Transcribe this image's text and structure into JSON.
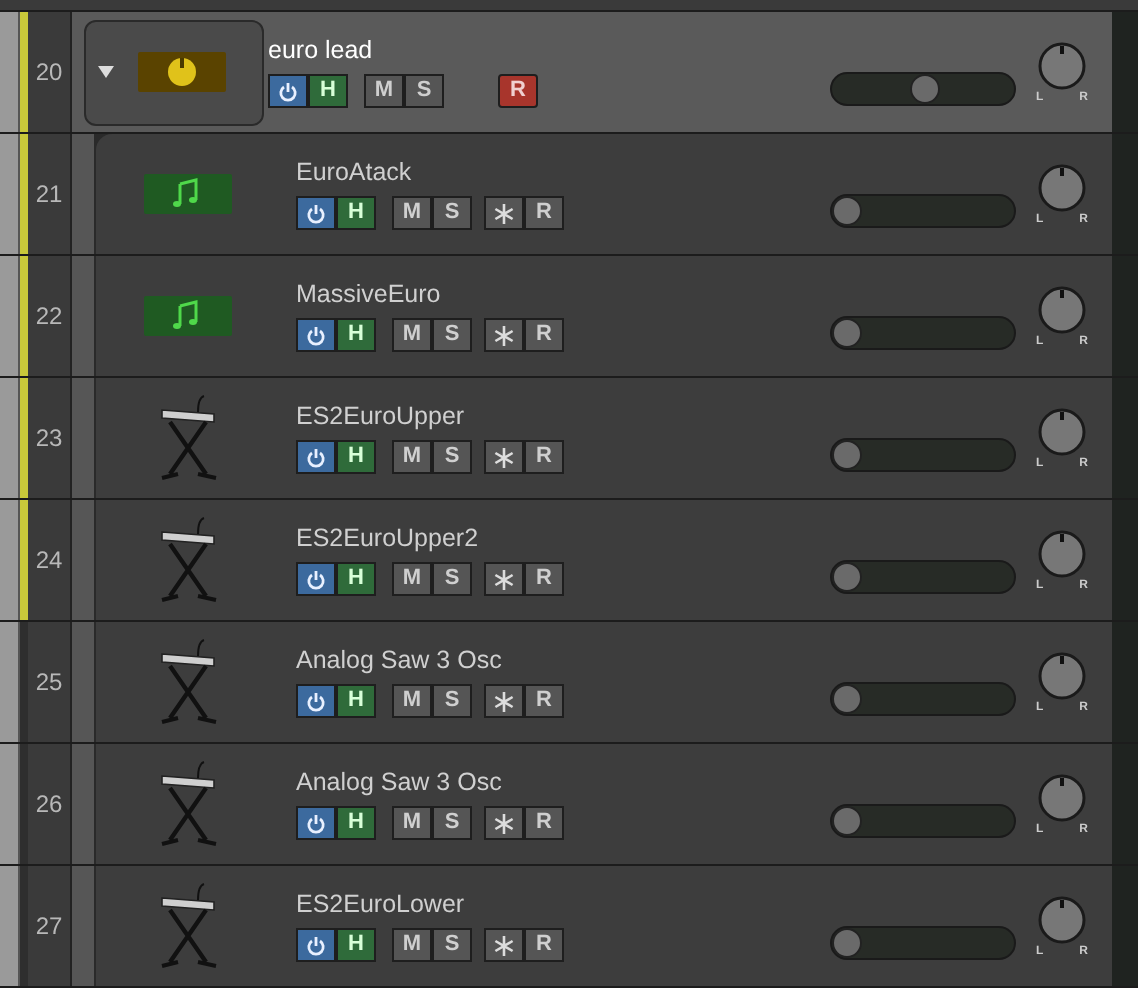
{
  "tracks": [
    {
      "number": "20",
      "name": "euro lead",
      "kind": "summing",
      "selected": true,
      "expanded": true,
      "marked": true,
      "buttons": {
        "power": true,
        "hide": "H",
        "mute": "M",
        "solo": "S",
        "record": "R"
      },
      "level": 0.5,
      "pan": {
        "left": "L",
        "right": "R"
      }
    },
    {
      "number": "21",
      "name": "EuroAtack",
      "kind": "audio",
      "selected": false,
      "marked": true,
      "buttons": {
        "power": true,
        "hide": "H",
        "mute": "M",
        "solo": "S",
        "record": "R"
      },
      "freeze": true,
      "level": 0,
      "pan": {
        "left": "L",
        "right": "R"
      }
    },
    {
      "number": "22",
      "name": "MassiveEuro",
      "kind": "audio",
      "selected": false,
      "marked": true,
      "buttons": {
        "power": true,
        "hide": "H",
        "mute": "M",
        "solo": "S",
        "record": "R"
      },
      "freeze": true,
      "level": 0,
      "pan": {
        "left": "L",
        "right": "R"
      }
    },
    {
      "number": "23",
      "name": "ES2EuroUpper",
      "kind": "instrument",
      "selected": false,
      "marked": true,
      "buttons": {
        "power": true,
        "hide": "H",
        "mute": "M",
        "solo": "S",
        "record": "R"
      },
      "freeze": true,
      "level": 0,
      "pan": {
        "left": "L",
        "right": "R"
      }
    },
    {
      "number": "24",
      "name": "ES2EuroUpper2",
      "kind": "instrument",
      "selected": false,
      "marked": true,
      "buttons": {
        "power": true,
        "hide": "H",
        "mute": "M",
        "solo": "S",
        "record": "R"
      },
      "freeze": true,
      "level": 0,
      "pan": {
        "left": "L",
        "right": "R"
      }
    },
    {
      "number": "25",
      "name": "Analog Saw 3 Osc",
      "kind": "instrument",
      "selected": false,
      "marked": false,
      "buttons": {
        "power": true,
        "hide": "H",
        "mute": "M",
        "solo": "S",
        "record": "R"
      },
      "freeze": true,
      "level": 0,
      "pan": {
        "left": "L",
        "right": "R"
      }
    },
    {
      "number": "26",
      "name": "Analog Saw 3 Osc",
      "kind": "instrument",
      "selected": false,
      "marked": false,
      "buttons": {
        "power": true,
        "hide": "H",
        "mute": "M",
        "solo": "S",
        "record": "R"
      },
      "freeze": true,
      "level": 0,
      "pan": {
        "left": "L",
        "right": "R"
      }
    },
    {
      "number": "27",
      "name": "ES2EuroLower",
      "kind": "instrument",
      "selected": false,
      "marked": false,
      "buttons": {
        "power": true,
        "hide": "H",
        "mute": "M",
        "solo": "S",
        "record": "R"
      },
      "freeze": true,
      "level": 0,
      "pan": {
        "left": "L",
        "right": "R"
      }
    }
  ]
}
